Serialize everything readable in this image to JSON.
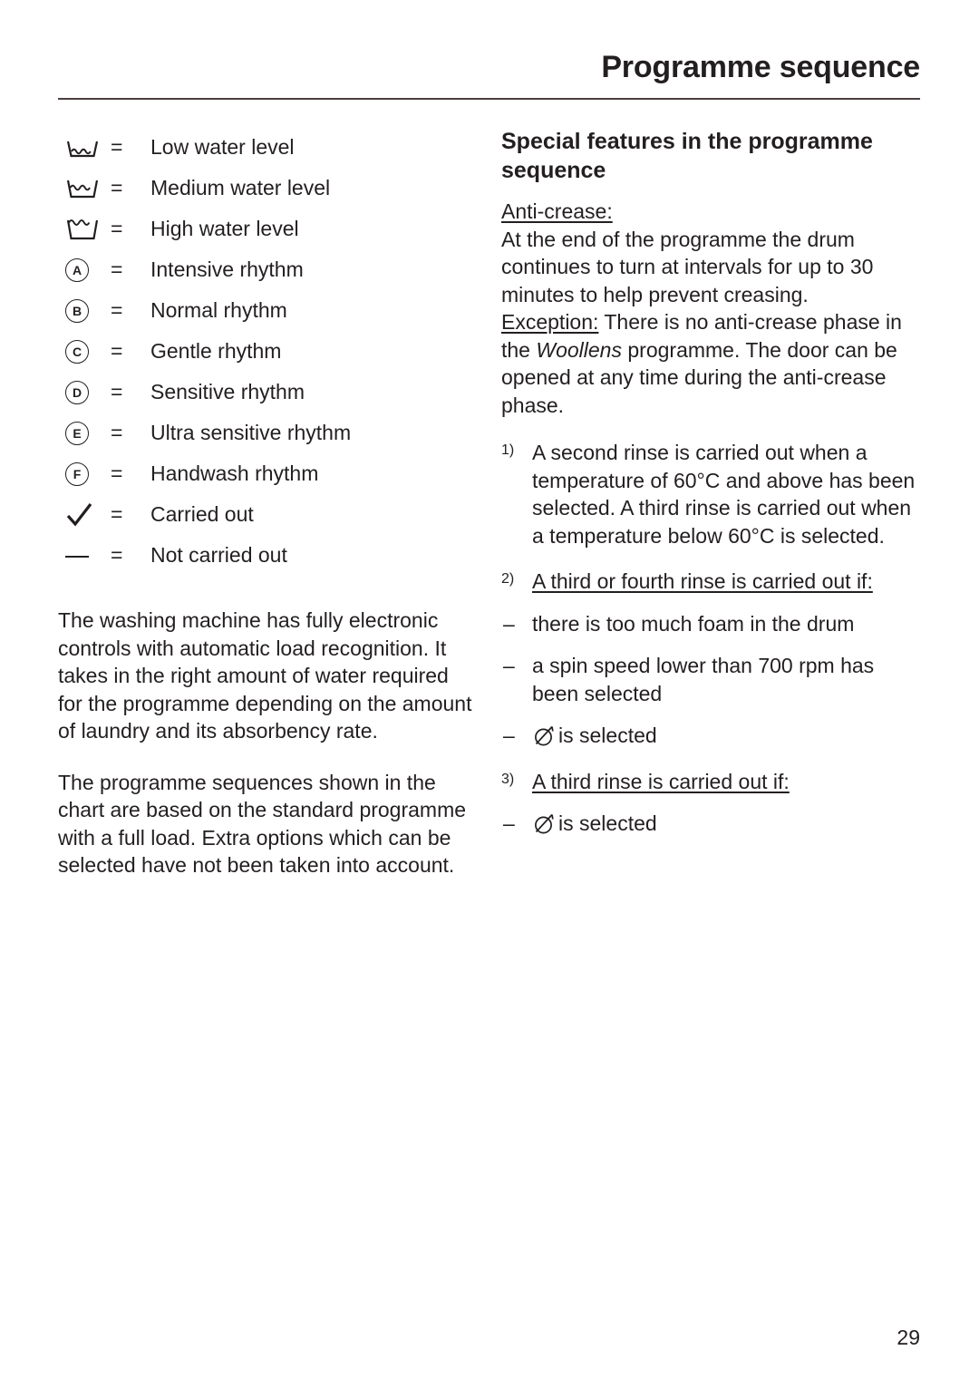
{
  "header": {
    "title": "Programme sequence"
  },
  "legend": {
    "equals": "=",
    "items": [
      {
        "symbol": "low-water-level-icon",
        "label": "Low water level"
      },
      {
        "symbol": "medium-water-level-icon",
        "label": "Medium water level"
      },
      {
        "symbol": "high-water-level-icon",
        "label": "High water level"
      },
      {
        "symbol": "circled-letter-a-icon",
        "letter": "A",
        "label": "Intensive rhythm"
      },
      {
        "symbol": "circled-letter-b-icon",
        "letter": "B",
        "label": "Normal rhythm"
      },
      {
        "symbol": "circled-letter-c-icon",
        "letter": "C",
        "label": "Gentle rhythm"
      },
      {
        "symbol": "circled-letter-d-icon",
        "letter": "D",
        "label": "Sensitive rhythm"
      },
      {
        "symbol": "circled-letter-e-icon",
        "letter": "E",
        "label": "Ultra sensitive rhythm"
      },
      {
        "symbol": "circled-letter-f-icon",
        "letter": "F",
        "label": "Handwash rhythm"
      },
      {
        "symbol": "checkmark-icon",
        "label": "Carried out"
      },
      {
        "symbol": "dash-icon",
        "label": "Not carried out"
      }
    ]
  },
  "left_column": {
    "paragraph_1": "The washing machine has fully electronic controls with automatic load recognition. It takes in the right amount of water required for the programme depending on the amount of laundry and its absorbency rate.",
    "paragraph_2": "The programme sequences shown in the chart are based on the standard programme with a full load. Extra options which can be selected have not been taken into account."
  },
  "right_column": {
    "heading": "Special features in the programme sequence",
    "anti_crease": {
      "label": "Anti-crease:",
      "body": "At the end of the programme the drum continues to turn at intervals for up to 30 minutes to help prevent creasing.",
      "exception_label": "Exception:",
      "exception_body_1": " There is no anti-crease phase in the ",
      "exception_italic": "Woollens",
      "exception_body_2": " programme. The door can be opened at any time during the anti-crease phase."
    },
    "footnotes": [
      {
        "mark": "1)",
        "text": "A second rinse is carried out when a temperature of 60°C and above has been selected. A third rinse is carried out when a temperature below 60°C is selected."
      },
      {
        "mark": "2)",
        "heading": "A third or fourth rinse is carried out if:",
        "bullets": [
          {
            "dash": "–",
            "text": "there is too much foam in the drum"
          },
          {
            "dash": "–",
            "text": "a spin speed lower than 700 rpm has been selected"
          },
          {
            "dash": "–",
            "icon": "no-spin-icon",
            "text": "is selected"
          }
        ]
      },
      {
        "mark": "3)",
        "heading": "A third rinse is carried out if:",
        "bullets": [
          {
            "dash": "–",
            "icon": "no-spin-icon",
            "text": "is selected"
          }
        ]
      }
    ]
  },
  "footer": {
    "page_number": "29"
  },
  "colors": {
    "text": "#231f20",
    "rule": "#4a3f3f",
    "background": "#ffffff"
  }
}
